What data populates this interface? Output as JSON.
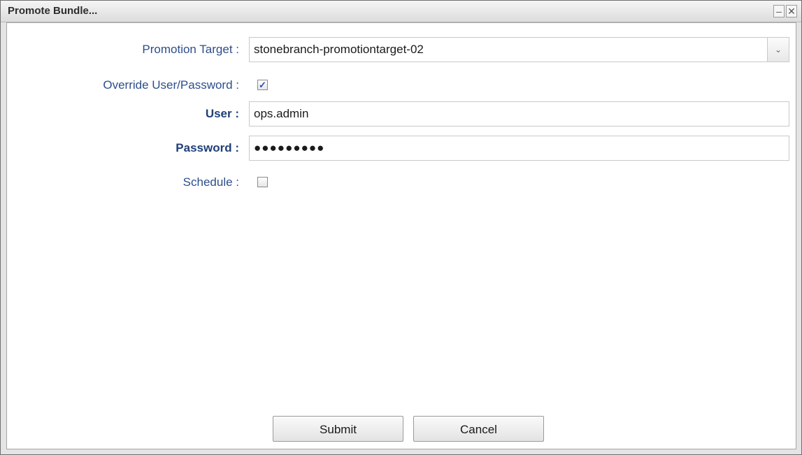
{
  "dialog": {
    "title": "Promote Bundle..."
  },
  "window_buttons": {
    "minimize": "–",
    "close": "✕"
  },
  "form": {
    "promotion_target": {
      "label": "Promotion Target :",
      "value": "stonebranch-promotiontarget-02",
      "arrow": "⌄"
    },
    "override": {
      "label": "Override User/Password :",
      "checked": true,
      "mark": "✓"
    },
    "user": {
      "label": "User :",
      "value": "ops.admin"
    },
    "password": {
      "label": "Password :",
      "value": "●●●●●●●●●"
    },
    "schedule": {
      "label": "Schedule :",
      "checked": false,
      "mark": ""
    }
  },
  "buttons": {
    "submit": "Submit",
    "cancel": "Cancel"
  },
  "icons": {
    "dropdown": "chevron-down-icon",
    "minimize": "minimize-icon",
    "close": "close-icon"
  }
}
